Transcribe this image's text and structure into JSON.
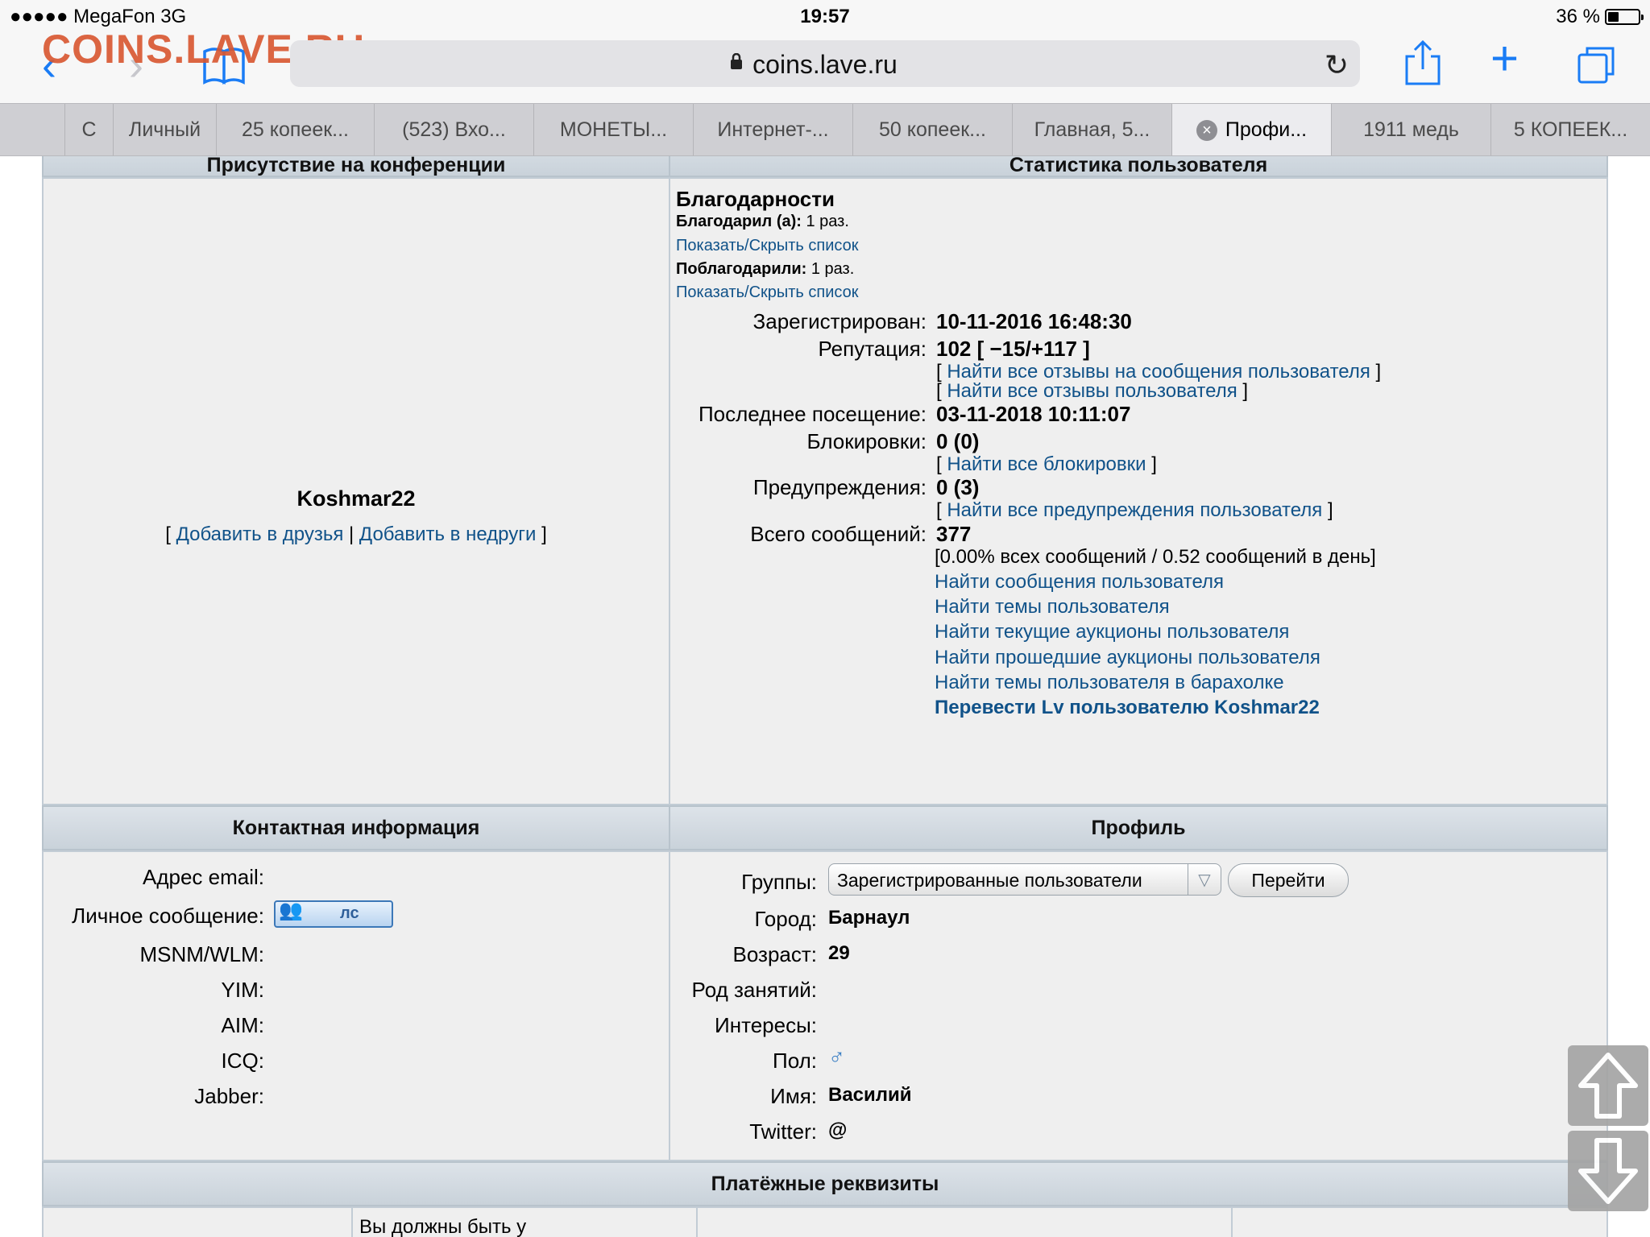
{
  "status": {
    "carrier": "●●●●● MegaFon  3G",
    "time": "19:57",
    "battery": "36 %",
    "battery_level": 0.36
  },
  "browser": {
    "watermark": "COINS.LAVE.RU",
    "url": "coins.lave.ru",
    "tabs": [
      {
        "label": "С"
      },
      {
        "label": "Личный"
      },
      {
        "label": "25 копеек..."
      },
      {
        "label": "(523) Вхо..."
      },
      {
        "label": "МОНЕТЫ..."
      },
      {
        "label": "Интернет-..."
      },
      {
        "label": "50 копеек..."
      },
      {
        "label": "Главная, 5..."
      },
      {
        "label": "Профи..."
      },
      {
        "label": "1911 медь"
      },
      {
        "label": "5 КОПЕЕК..."
      }
    ]
  },
  "page": {
    "presence_header": "Присутствие на конференции",
    "stats_header": "Статистика пользователя",
    "username": "Koshmar22",
    "friend_links": {
      "open": "[",
      "add_friend": "Добавить в друзья",
      "sep": "|",
      "add_foe": "Добавить в недруги",
      "close": "]"
    },
    "thanks": {
      "title": "Благодарности",
      "gave_label": "Благодарил (а):",
      "gave_value": "1 раз.",
      "toggle1": "Показать/Скрыть список",
      "got_label": "Поблагодарили:",
      "got_value": "1 раз.",
      "toggle2": "Показать/Скрыть список"
    },
    "stats": {
      "registered_label": "Зарегистрирован:",
      "registered_value": "10-11-2016 16:48:30",
      "reputation_label": "Репутация:",
      "reputation_value": "102 [ −15/+117 ]",
      "rep_link1": "Найти все отзывы на сообщения пользователя",
      "rep_link2": "Найти все отзывы пользователя",
      "last_visit_label": "Последнее посещение:",
      "last_visit_value": "03-11-2018 10:11:07",
      "bans_label": "Блокировки:",
      "bans_value": "0 (0)",
      "bans_link": "Найти все блокировки",
      "warnings_label": "Предупреждения:",
      "warnings_value": "0 (3)",
      "warnings_link": "Найти все предупреждения пользователя",
      "posts_label": "Всего сообщений:",
      "posts_value": "377",
      "posts_detail": "[0.00% всех сообщений / 0.52 сообщений в день]",
      "links": [
        "Найти сообщения пользователя",
        "Найти темы пользователя",
        "Найти текущие аукционы пользователя",
        "Найти прошедшие аукционы пользователя",
        "Найти темы пользователя в барахолке"
      ],
      "transfer_link": "Перевести Lv пользователю Koshmar22",
      "bracket_open": "[",
      "bracket_close": "]"
    },
    "contact_header": "Контактная информация",
    "profile_header": "Профиль",
    "contact": {
      "email_label": "Адрес email:",
      "pm_label": "Личное сообщение:",
      "pm_button": "лс",
      "msnm_label": "MSNM/WLM:",
      "yim_label": "YIM:",
      "aim_label": "AIM:",
      "icq_label": "ICQ:",
      "jabber_label": "Jabber:"
    },
    "profile": {
      "groups_label": "Группы:",
      "groups_selected": "Зарегистрированные пользователи",
      "go_button": "Перейти",
      "city_label": "Город:",
      "city_value": "Барнаул",
      "age_label": "Возраст:",
      "age_value": "29",
      "occupation_label": "Род занятий:",
      "interests_label": "Интересы:",
      "gender_label": "Пол:",
      "gender_icon": "male-icon",
      "name_label": "Имя:",
      "name_value": "Василий",
      "twitter_label": "Twitter:",
      "twitter_value": "@"
    },
    "payment_header": "Платёжные реквизиты",
    "payment_partial": "Вы должны быть у"
  },
  "colors": {
    "link": "#105289",
    "accent": "#1a7cf5",
    "watermark": "#d8562f"
  }
}
